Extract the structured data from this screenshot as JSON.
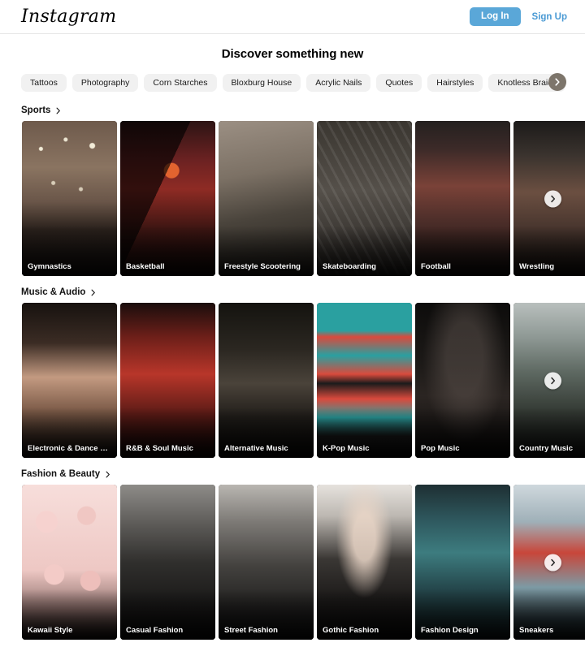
{
  "header": {
    "logo_text": "Instagram",
    "login_label": "Log In",
    "signup_label": "Sign Up"
  },
  "page_title": "Discover something new",
  "chips": {
    "items": [
      {
        "label": "Tattoos"
      },
      {
        "label": "Photography"
      },
      {
        "label": "Corn Starches"
      },
      {
        "label": "Bloxburg House"
      },
      {
        "label": "Acrylic Nails"
      },
      {
        "label": "Quotes"
      },
      {
        "label": "Hairstyles"
      },
      {
        "label": "Knotless Braids"
      }
    ],
    "next_icon": "chevron-right-icon"
  },
  "colors": {
    "accent_blue": "#5aa7d8",
    "link_blue": "#4a9ad4",
    "chip_bg": "#f1f1f1",
    "chip_arrow_bg": "#7d756b",
    "page_bg": "#ffffff",
    "border": "#e6e6e6"
  },
  "sections": [
    {
      "title": "Sports",
      "chevron_icon": "chevron-right-icon",
      "next_icon": "chevron-right-icon",
      "cards": [
        {
          "label": "Gymnastics",
          "art": "a-gym"
        },
        {
          "label": "Basketball",
          "art": "a-basket"
        },
        {
          "label": "Freestyle Scootering",
          "art": "a-scoot"
        },
        {
          "label": "Skateboarding",
          "art": "a-skate"
        },
        {
          "label": "Football",
          "art": "a-football"
        },
        {
          "label": "Wrestling",
          "art": "a-wrestle"
        }
      ]
    },
    {
      "title": "Music & Audio",
      "chevron_icon": "chevron-right-icon",
      "next_icon": "chevron-right-icon",
      "cards": [
        {
          "label": "Electronic & Dance M...",
          "art": "a-edm"
        },
        {
          "label": "R&B & Soul Music",
          "art": "a-rnb"
        },
        {
          "label": "Alternative Music",
          "art": "a-alt"
        },
        {
          "label": "K-Pop Music",
          "art": "a-kpop"
        },
        {
          "label": "Pop Music",
          "art": "a-pop"
        },
        {
          "label": "Country Music",
          "art": "a-country"
        }
      ]
    },
    {
      "title": "Fashion & Beauty",
      "chevron_icon": "chevron-right-icon",
      "next_icon": "chevron-right-icon",
      "cards": [
        {
          "label": "Kawaii Style",
          "art": "a-kawaii"
        },
        {
          "label": "Casual Fashion",
          "art": "a-casual"
        },
        {
          "label": "Street Fashion",
          "art": "a-street"
        },
        {
          "label": "Gothic Fashion",
          "art": "a-gothic"
        },
        {
          "label": "Fashion Design",
          "art": "a-design"
        },
        {
          "label": "Sneakers",
          "art": "a-sneaker"
        }
      ]
    }
  ]
}
